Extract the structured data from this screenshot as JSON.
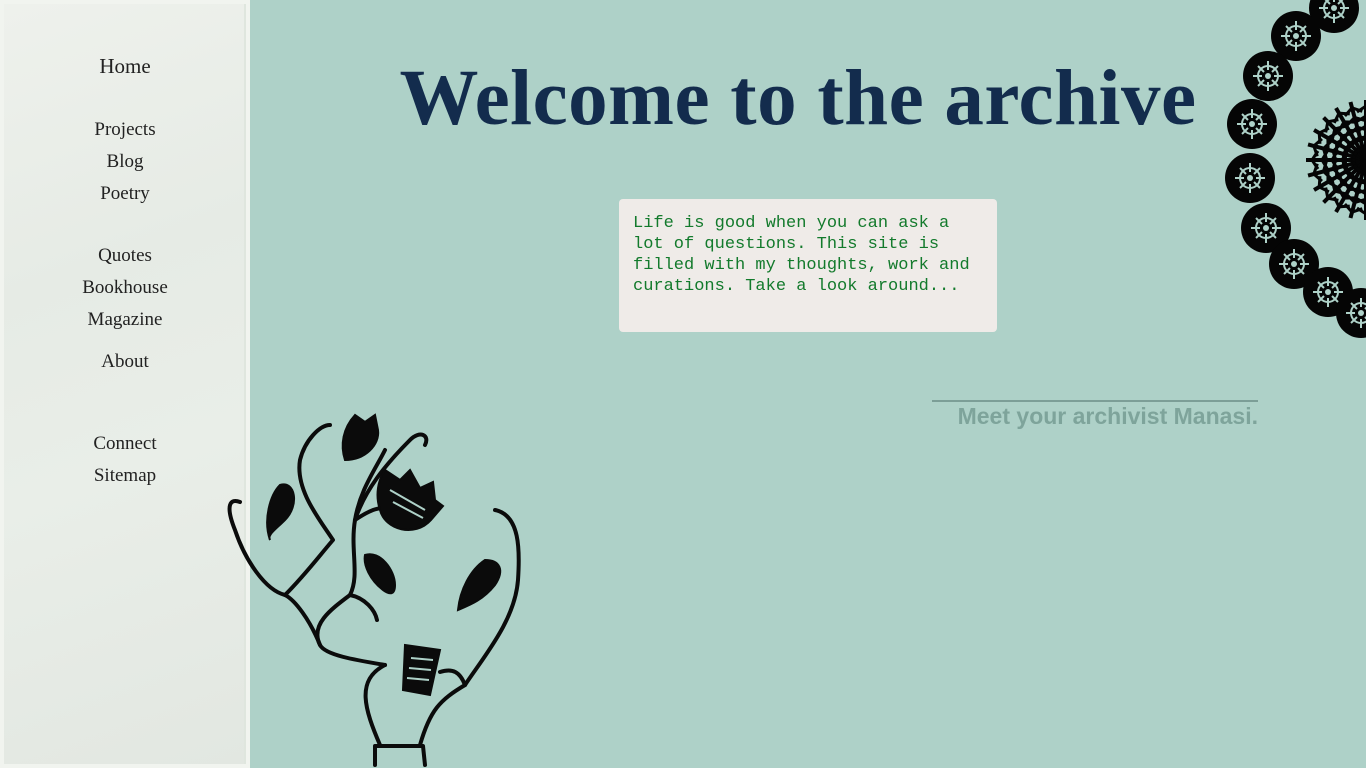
{
  "nav": {
    "home": "Home",
    "projects": "Projects",
    "blog": "Blog",
    "poetry": "Poetry",
    "quotes": "Quotes",
    "bookhouse": "Bookhouse",
    "magazine": "Magazine",
    "about": "About",
    "connect": "Connect",
    "sitemap": "Sitemap"
  },
  "header": {
    "title": "Welcome to the archive"
  },
  "intro": {
    "text": "Life is good when you can ask a lot of questions. This site is filled with my thoughts, work and curations. Take a look around..."
  },
  "archivist_link": "Meet your archivist Manasi.",
  "colors": {
    "background": "#aed1c8",
    "title": "#132c4d",
    "intro_text": "#137a2c",
    "archivist_text": "#7ea49b"
  },
  "icons": {
    "plant": "plant-illustration",
    "mandala": "mandala-ornament"
  }
}
